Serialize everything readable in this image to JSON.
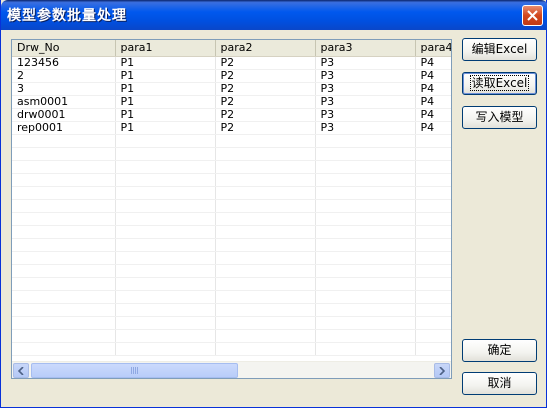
{
  "window": {
    "title": "模型参数批量处理"
  },
  "grid": {
    "columns": [
      "Drw_No",
      "para1",
      "para2",
      "para3",
      "para4"
    ],
    "rows": [
      [
        "123456",
        "P1",
        "P2",
        "P3",
        "P4"
      ],
      [
        "2",
        "P1",
        "P2",
        "P3",
        "P4"
      ],
      [
        "3",
        "P1",
        "P2",
        "P3",
        "P4"
      ],
      [
        "asm0001",
        "P1",
        "P2",
        "P3",
        "P4"
      ],
      [
        "drw0001",
        "P1",
        "P2",
        "P3",
        "P4"
      ],
      [
        "rep0001",
        "P1",
        "P2",
        "P3",
        "P4"
      ]
    ]
  },
  "buttons": {
    "edit_excel": "编辑Excel",
    "read_excel": "读取Excel",
    "write_model": "写入模型",
    "ok": "确定",
    "cancel": "取消"
  }
}
